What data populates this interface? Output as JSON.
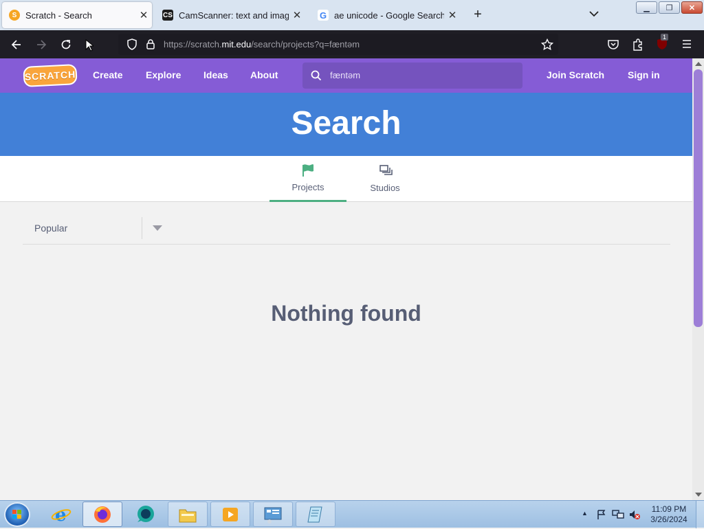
{
  "browser": {
    "tabs": [
      {
        "title": "Scratch - Search",
        "favicon": "scratch-cat-icon",
        "active": true
      },
      {
        "title": "CamScanner: text and image sc",
        "favicon": "camscanner-icon",
        "active": false
      },
      {
        "title": "ae unicode - Google Search",
        "favicon": "google-icon",
        "active": false
      }
    ],
    "url_prefix": "https://scratch.",
    "url_domain": "mit.edu",
    "url_path": "/search/projects?q=fæntəm",
    "extension_badge": "1"
  },
  "scratch": {
    "logo_text": "SCRATCH",
    "nav": [
      "Create",
      "Explore",
      "Ideas",
      "About"
    ],
    "search_value": "fæntəm",
    "join_label": "Join Scratch",
    "signin_label": "Sign in",
    "banner_title": "Search",
    "tabs": [
      {
        "label": "Projects",
        "icon": "flag-icon",
        "active": true
      },
      {
        "label": "Studios",
        "icon": "studios-icon",
        "active": false
      }
    ],
    "sort_selected": "Popular",
    "empty_message": "Nothing found",
    "colors": {
      "header": "#855cd6",
      "banner": "#4280d7",
      "active_tab": "#4caf82"
    }
  },
  "taskbar": {
    "time": "11:09 PM",
    "date": "3/26/2024"
  }
}
